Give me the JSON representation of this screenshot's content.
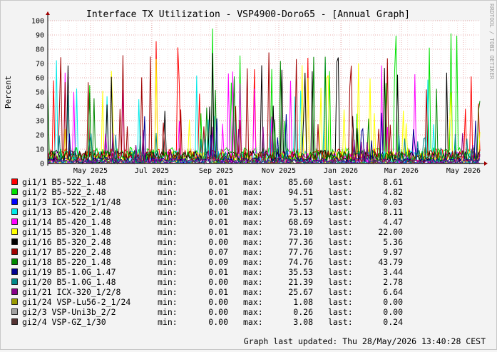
{
  "chart_data": {
    "type": "line",
    "title": "Interface TX Utilization - VSP4900-Doro65 - [Annual Graph]",
    "ylabel": "Percent",
    "ylim": [
      0,
      100
    ],
    "yticks": [
      0,
      10,
      20,
      30,
      40,
      50,
      60,
      70,
      80,
      90,
      100
    ],
    "xticks": [
      "May 2025",
      "Jul 2025",
      "Sep 2025",
      "Nov 2025",
      "Jan 2026",
      "Mar 2026",
      "May 2026"
    ],
    "grid": true,
    "watermark": "RRDTOOL / TOBI OETIKER",
    "last_updated": "Graph last updated: Thu 28/May/2026 13:40:28 CEST",
    "stat_labels": {
      "min": "min:",
      "max": "max:",
      "last": "last:"
    },
    "series": [
      {
        "name": "gi1/1 B5-522_1.48",
        "color": "#ff0000",
        "min": "0.01",
        "max": "85.60",
        "last": "8.61"
      },
      {
        "name": "gi1/2 B5-522_2.48",
        "color": "#00e000",
        "min": "0.01",
        "max": "94.51",
        "last": "4.82"
      },
      {
        "name": "gi1/3 ICX-522_1/1/48",
        "color": "#0000ff",
        "min": "0.00",
        "max": "5.57",
        "last": "0.03"
      },
      {
        "name": "gi1/13 B5-420_2.48",
        "color": "#00e8e8",
        "min": "0.01",
        "max": "73.13",
        "last": "8.11"
      },
      {
        "name": "gi1/14 B5-420_1.48",
        "color": "#ff00ff",
        "min": "0.01",
        "max": "68.69",
        "last": "4.47"
      },
      {
        "name": "gi1/15 B5-320_1.48",
        "color": "#ffff00",
        "min": "0.01",
        "max": "73.10",
        "last": "22.00"
      },
      {
        "name": "gi1/16 B5-320_2.48",
        "color": "#000000",
        "min": "0.00",
        "max": "77.36",
        "last": "5.36"
      },
      {
        "name": "gi1/17 B5-220_2.48",
        "color": "#a00000",
        "min": "0.07",
        "max": "77.76",
        "last": "9.97"
      },
      {
        "name": "gi1/18 B5-220_1.48",
        "color": "#008800",
        "min": "0.09",
        "max": "74.76",
        "last": "43.79"
      },
      {
        "name": "gi1/19 B5-1.0G_1.47",
        "color": "#000090",
        "min": "0.01",
        "max": "35.53",
        "last": "3.44"
      },
      {
        "name": "gi1/20 B5-1.0G_1.48",
        "color": "#008888",
        "min": "0.00",
        "max": "21.39",
        "last": "2.78"
      },
      {
        "name": "gi1/21 ICX-320_1/2/8",
        "color": "#880088",
        "min": "0.01",
        "max": "25.67",
        "last": "6.64"
      },
      {
        "name": "gi1/24 VSP-Lu56-2_1/24",
        "color": "#999900",
        "min": "0.00",
        "max": "1.08",
        "last": "0.00"
      },
      {
        "name": "gi2/3 VSP-Uni3b_2/2",
        "color": "#a0a0a0",
        "min": "0.00",
        "max": "0.26",
        "last": "0.00"
      },
      {
        "name": "gi2/4 VSP-GZ_1/30",
        "color": "#553333",
        "min": "0.00",
        "max": "3.08",
        "last": "0.24"
      }
    ]
  }
}
